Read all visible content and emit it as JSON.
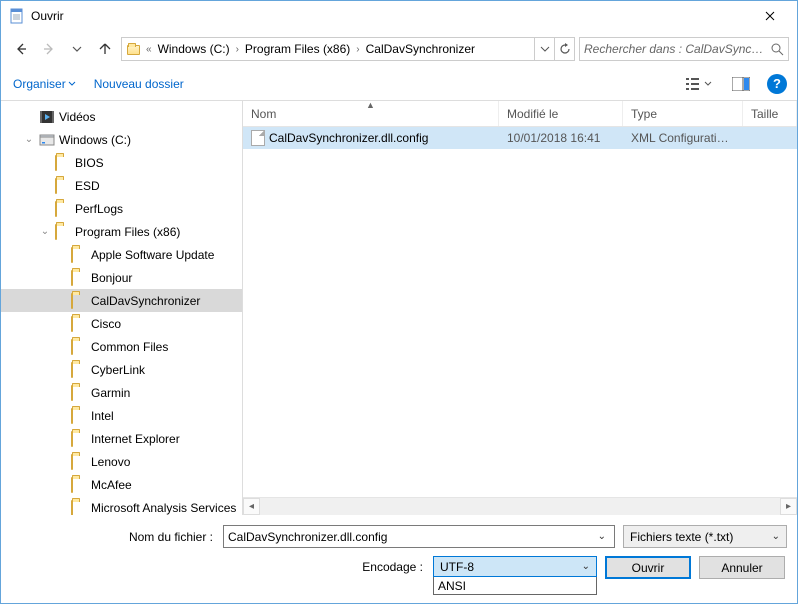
{
  "dialog_title": "Ouvrir",
  "nav": {
    "back_enabled": true,
    "fwd_enabled": false
  },
  "breadcrumb": {
    "overflow": "«",
    "segs": [
      "Windows (C:)",
      "Program Files (x86)",
      "CalDavSynchronizer"
    ]
  },
  "search_placeholder": "Rechercher dans : CalDavSync…",
  "toolbar": {
    "organize": "Organiser",
    "newfolder": "Nouveau dossier"
  },
  "tree": [
    {
      "depth": 1,
      "icon": "videos",
      "label": "Vidéos",
      "exp": ""
    },
    {
      "depth": 1,
      "icon": "drive",
      "label": "Windows (C:)",
      "exp": "v"
    },
    {
      "depth": 2,
      "icon": "folder",
      "label": "BIOS",
      "exp": ""
    },
    {
      "depth": 2,
      "icon": "folder",
      "label": "ESD",
      "exp": ""
    },
    {
      "depth": 2,
      "icon": "folder",
      "label": "PerfLogs",
      "exp": ""
    },
    {
      "depth": 2,
      "icon": "folder-open",
      "label": "Program Files (x86)",
      "exp": "v"
    },
    {
      "depth": 3,
      "icon": "folder",
      "label": "Apple Software Update",
      "exp": ""
    },
    {
      "depth": 3,
      "icon": "folder",
      "label": "Bonjour",
      "exp": ""
    },
    {
      "depth": 3,
      "icon": "folder-open",
      "label": "CalDavSynchronizer",
      "exp": "",
      "selected": true
    },
    {
      "depth": 3,
      "icon": "folder",
      "label": "Cisco",
      "exp": ""
    },
    {
      "depth": 3,
      "icon": "folder",
      "label": "Common Files",
      "exp": ""
    },
    {
      "depth": 3,
      "icon": "folder",
      "label": "CyberLink",
      "exp": ""
    },
    {
      "depth": 3,
      "icon": "folder",
      "label": "Garmin",
      "exp": ""
    },
    {
      "depth": 3,
      "icon": "folder",
      "label": "Intel",
      "exp": ""
    },
    {
      "depth": 3,
      "icon": "folder",
      "label": "Internet Explorer",
      "exp": ""
    },
    {
      "depth": 3,
      "icon": "folder",
      "label": "Lenovo",
      "exp": ""
    },
    {
      "depth": 3,
      "icon": "folder",
      "label": "McAfee",
      "exp": ""
    },
    {
      "depth": 3,
      "icon": "folder",
      "label": "Microsoft Analysis Services",
      "exp": ""
    }
  ],
  "columns": {
    "name": "Nom",
    "modified": "Modifié le",
    "type": "Type",
    "size": "Taille"
  },
  "rows": [
    {
      "name": "CalDavSynchronizer.dll.config",
      "modified": "10/01/2018 16:41",
      "type": "XML Configuratio…",
      "selected": true
    }
  ],
  "filename_label": "Nom du fichier :",
  "filename_value": "CalDavSynchronizer.dll.config",
  "filter_label": "Fichiers texte (*.txt)",
  "encoding_label": "Encodage :",
  "encoding_selected": "UTF-8",
  "encoding_options": [
    "ANSI"
  ],
  "open_btn": "Ouvrir",
  "cancel_btn": "Annuler"
}
